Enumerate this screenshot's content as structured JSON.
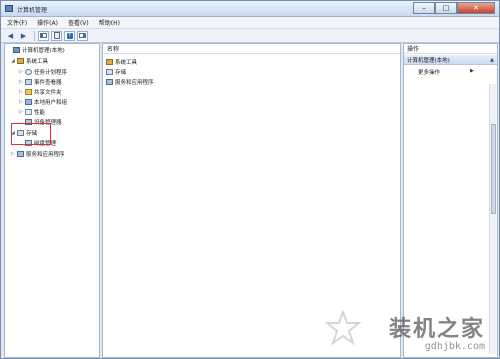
{
  "window": {
    "title": "计算机管理",
    "controls": {
      "minimize": "–",
      "maximize": "□",
      "close": "✕"
    }
  },
  "menu": [
    "文件(F)",
    "操作(A)",
    "查看(V)",
    "帮助(H)"
  ],
  "toolbar": {
    "back": "◀",
    "forward": "▶"
  },
  "tree": [
    {
      "label": "计算机管理(本地)",
      "icon": "computer-icon",
      "level": 0,
      "expander": ""
    },
    {
      "label": "系统工具",
      "icon": "tools-icon",
      "level": 1,
      "expander": "◢"
    },
    {
      "label": "任务计划程序",
      "icon": "clock-icon",
      "level": 2,
      "expander": "▷"
    },
    {
      "label": "事件查看器",
      "icon": "event-viewer-icon",
      "level": 2,
      "expander": "▷"
    },
    {
      "label": "共享文件夹",
      "icon": "folder-icon",
      "level": 2,
      "expander": "▷"
    },
    {
      "label": "本地用户和组",
      "icon": "users-icon",
      "level": 2,
      "expander": "▷"
    },
    {
      "label": "性能",
      "icon": "performance-icon",
      "level": 2,
      "expander": "▷"
    },
    {
      "label": "设备管理器",
      "icon": "device-icon",
      "level": 2,
      "expander": ""
    },
    {
      "label": "存储",
      "icon": "storage-icon",
      "level": 1,
      "expander": "◢"
    },
    {
      "label": "磁盘管理",
      "icon": "disk-icon",
      "level": 2,
      "expander": ""
    },
    {
      "label": "服务和应用程序",
      "icon": "services-icon",
      "level": 1,
      "expander": "▷"
    }
  ],
  "list": {
    "header": "名称",
    "items": [
      {
        "label": "系统工具",
        "icon": "tools-icon"
      },
      {
        "label": "存储",
        "icon": "storage-icon"
      },
      {
        "label": "服务和应用程序",
        "icon": "services-icon"
      }
    ]
  },
  "actions": {
    "header": "操作",
    "group": "计算机管理(本地)",
    "group_caret": "▲",
    "more": "更多操作",
    "more_arrow": "▶"
  },
  "watermark": {
    "big": "装机之家",
    "small": "gdhjbk.com"
  },
  "colors": {
    "highlight": "#e0312e",
    "title_bar": "#c9d9ee",
    "action_group": "#cadcf2"
  }
}
